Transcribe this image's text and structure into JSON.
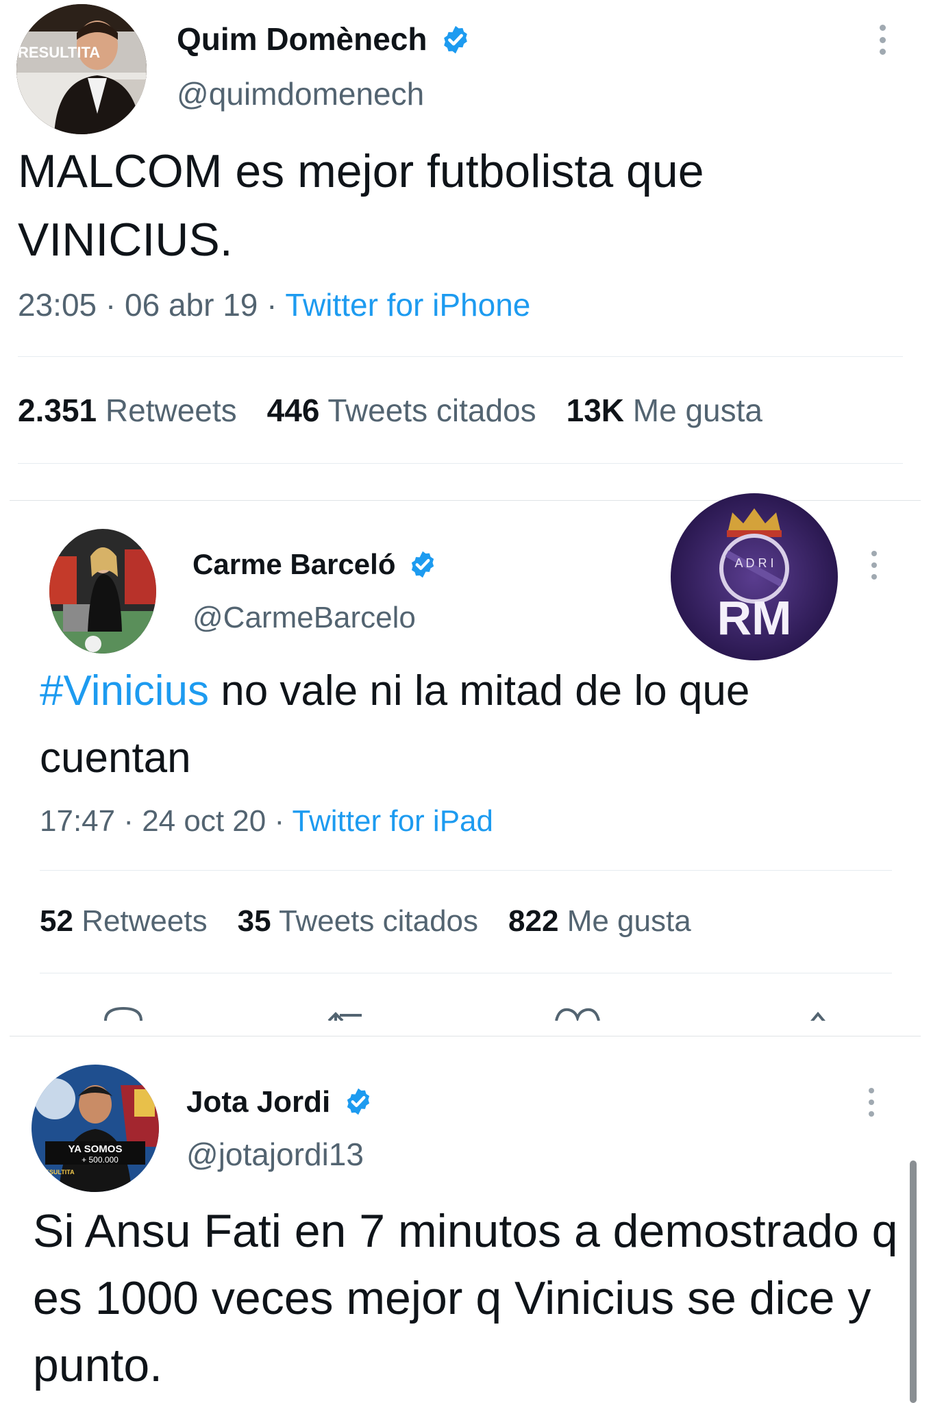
{
  "tweets": [
    {
      "name": "Quim Domènech",
      "handle": "@quimdomenech",
      "text": "MALCOM es mejor futbolista que VINICIUS.",
      "time": "23:05 · 06 abr 19 · ",
      "source": "Twitter for iPhone",
      "retweets_count": "2.351",
      "retweets_label": "Retweets",
      "quotes_count": "446",
      "quotes_label": "Tweets citados",
      "likes_count": "13K",
      "likes_label": "Me gusta",
      "avatar_text": "RESULTITA"
    },
    {
      "name": "Carme Barceló",
      "handle": "@CarmeBarcelo",
      "hashtag": "#Vinicius",
      "text": " no vale ni la mitad de lo que cuentan",
      "time": "17:47 · 24 oct 20 · ",
      "source": "Twitter for iPad",
      "retweets_count": "52",
      "retweets_label": "Retweets",
      "quotes_count": "35",
      "quotes_label": "Tweets citados",
      "likes_count": "822",
      "likes_label": "Me gusta"
    },
    {
      "name": "Jota Jordi",
      "handle": "@jotajordi13",
      "text": "Si Ansu Fati en 7 minutos a demostrado q es 1000 veces mejor q Vinicius se dice y punto.",
      "avatar_text_1": "YA SOMOS",
      "avatar_text_2": "+ 500.000",
      "avatar_text_3": "RESULTITA"
    }
  ],
  "watermark": {
    "top": "A D R I",
    "main": "RM"
  },
  "colors": {
    "accent": "#1d9bf0",
    "text": "#0f1419",
    "muted": "#536471",
    "divider": "#e6ecf0",
    "watermark_bg": "#3a2566"
  },
  "icons": [
    "verified-badge-icon",
    "more-options-icon",
    "reply-icon",
    "retweet-icon",
    "like-icon",
    "share-icon"
  ]
}
